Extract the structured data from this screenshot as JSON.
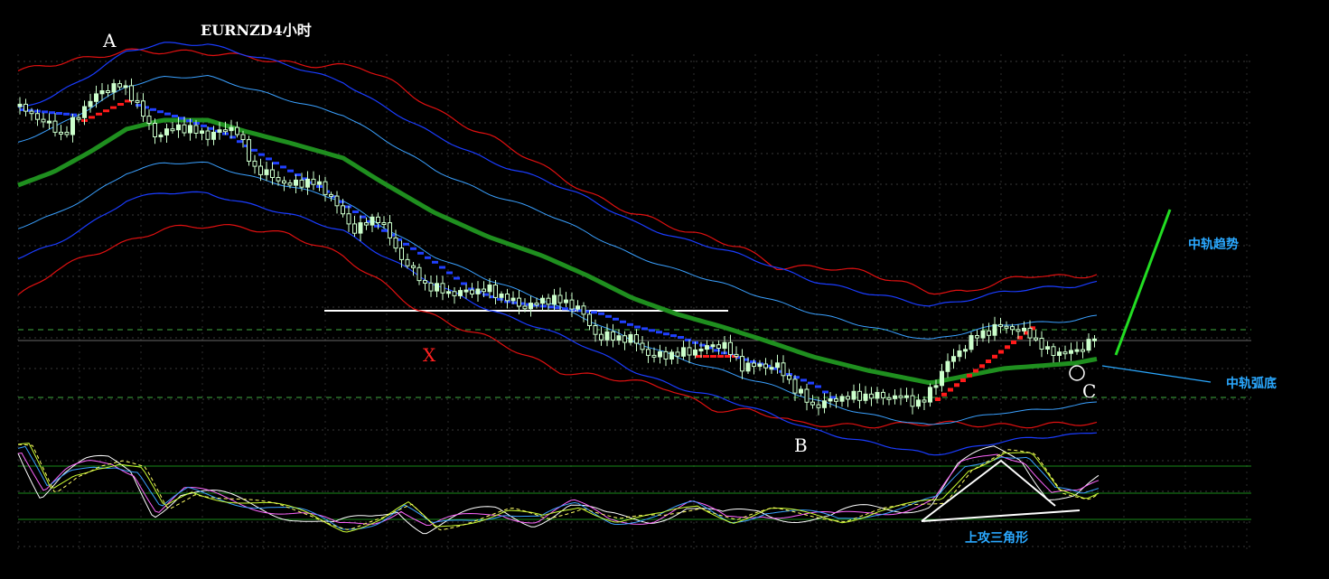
{
  "chart_data": {
    "type": "candlestick",
    "title": "EURNZD4小时",
    "point_labels": {
      "A": "A",
      "X": "X",
      "B": "B",
      "C": "C"
    },
    "annotations": {
      "mid_trend": "中轨趋势",
      "mid_arc_bottom": "中轨弧底",
      "ascending_triangle": "上攻三角形"
    },
    "grid": true,
    "indicators": [
      "price bands (upper/lower)",
      "middle band",
      "trend dots",
      "stochastic oscillator"
    ],
    "colors": {
      "background": "#000000",
      "candle": "#ccffcc",
      "middle_band": "#1f8f1f",
      "outer_band": "#e01010",
      "inner_band": "#1a3cff",
      "light_band": "#3aa0ff",
      "dots_down": "#2040ff",
      "dots_up": "#ff1a1a",
      "annotation_text": "#2aa8ff",
      "trend_arrow": "#22dd22"
    }
  }
}
